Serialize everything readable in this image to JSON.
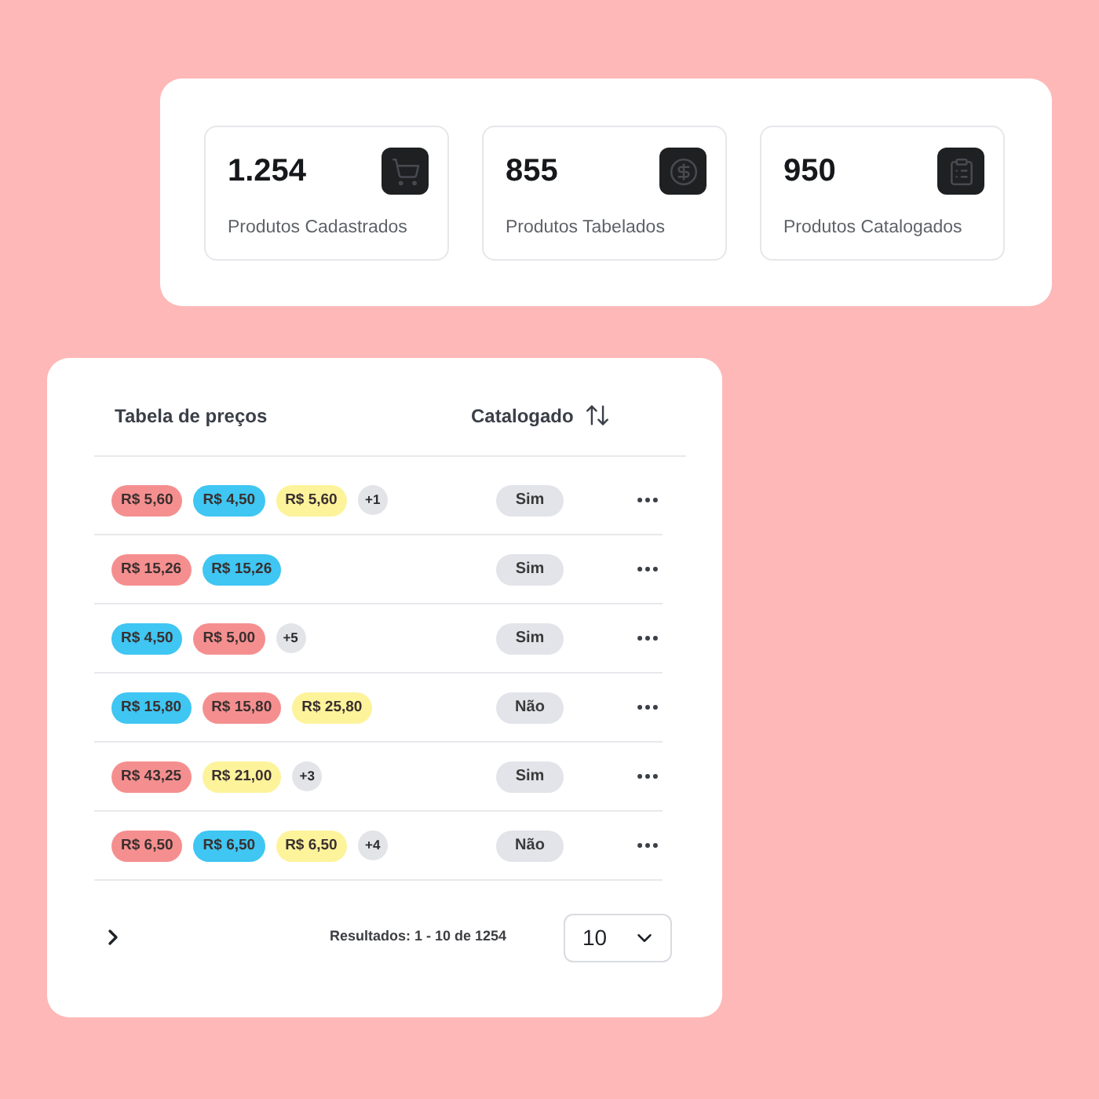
{
  "stats": [
    {
      "value": "1.254",
      "label": "Produtos Cadastrados"
    },
    {
      "value": "855",
      "label": "Produtos Tabelados"
    },
    {
      "value": "950",
      "label": "Produtos Catalogados"
    }
  ],
  "table": {
    "columns": [
      {
        "label": "Tabela de preços",
        "sortable": false
      },
      {
        "label": "Catalogado",
        "sortable": true
      }
    ],
    "rows": [
      {
        "tags": [
          {
            "kind": "price",
            "text": "R$ 5,60",
            "color": "#f58f8f"
          },
          {
            "kind": "price",
            "text": "R$ 4,50",
            "color": "#3fc6f2"
          },
          {
            "kind": "price",
            "text": "R$ 5,60",
            "color": "#fdf39b"
          },
          {
            "kind": "more",
            "text": "+1"
          }
        ],
        "catalogado": "Sim"
      },
      {
        "tags": [
          {
            "kind": "price",
            "text": "R$ 15,26",
            "color": "#f58f8f"
          },
          {
            "kind": "price",
            "text": "R$ 15,26",
            "color": "#3fc6f2"
          }
        ],
        "catalogado": "Sim"
      },
      {
        "tags": [
          {
            "kind": "price",
            "text": "R$ 4,50",
            "color": "#3fc6f2"
          },
          {
            "kind": "price",
            "text": "R$ 5,00",
            "color": "#f58f8f"
          },
          {
            "kind": "more",
            "text": "+5"
          }
        ],
        "catalogado": "Sim"
      },
      {
        "tags": [
          {
            "kind": "price",
            "text": "R$ 15,80",
            "color": "#3fc6f2"
          },
          {
            "kind": "price",
            "text": "R$ 15,80",
            "color": "#f58f8f"
          },
          {
            "kind": "price",
            "text": "R$ 25,80",
            "color": "#fdf39b"
          }
        ],
        "catalogado": "Não"
      },
      {
        "tags": [
          {
            "kind": "price",
            "text": "R$ 43,25",
            "color": "#f58f8f"
          },
          {
            "kind": "price",
            "text": "R$ 21,00",
            "color": "#fdf39b"
          },
          {
            "kind": "more",
            "text": "+3"
          }
        ],
        "catalogado": "Sim"
      },
      {
        "tags": [
          {
            "kind": "price",
            "text": "R$ 6,50",
            "color": "#f58f8f"
          },
          {
            "kind": "price",
            "text": "R$ 6,50",
            "color": "#3fc6f2"
          },
          {
            "kind": "price",
            "text": "R$ 6,50",
            "color": "#fdf39b"
          },
          {
            "kind": "more",
            "text": "+4"
          }
        ],
        "catalogado": "Não"
      }
    ]
  },
  "pagination": {
    "results": "Resultados: 1 - 10 de 1254",
    "page_size": "10"
  }
}
